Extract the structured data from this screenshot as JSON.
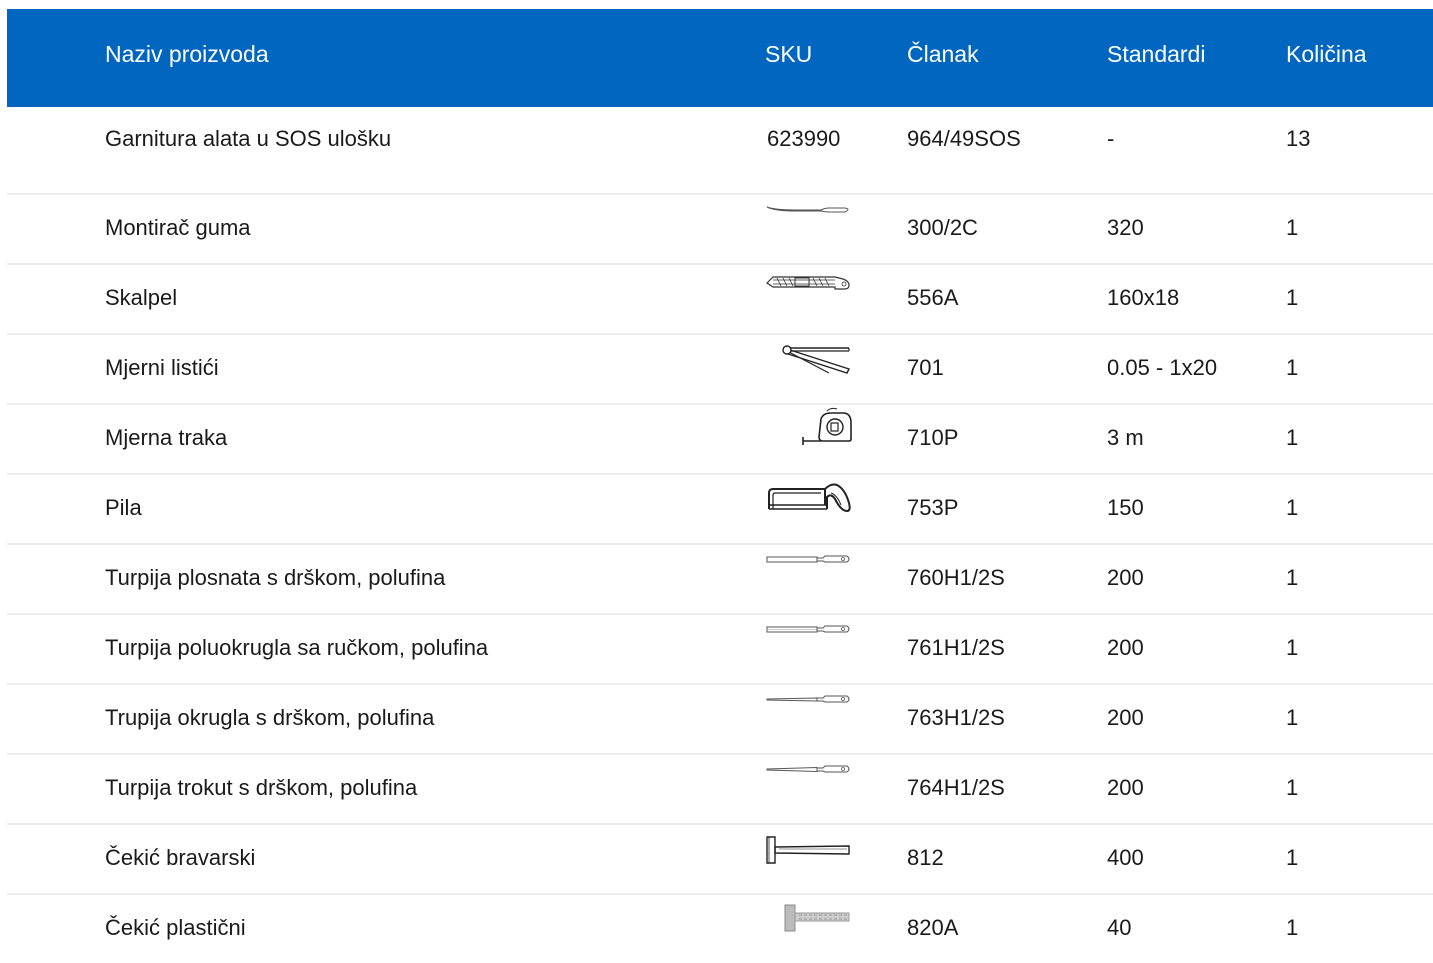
{
  "header": {
    "name": "Naziv proizvoda",
    "sku": "SKU",
    "article": "Članak",
    "standards": "Standardi",
    "quantity": "Količina"
  },
  "rows": [
    {
      "name": "Garnitura alata u SOS ulošku",
      "sku": "623990",
      "article": "964/49SOS",
      "standard": "-",
      "qty": "13"
    },
    {
      "name": "Montirač guma",
      "sku_icon": "tire-lever-icon",
      "article": "300/2C",
      "standard": "320",
      "qty": "1"
    },
    {
      "name": "Skalpel",
      "sku_icon": "utility-knife-icon",
      "article": "556A",
      "standard": "160x18",
      "qty": "1"
    },
    {
      "name": "Mjerni listići",
      "sku_icon": "feeler-gauge-icon",
      "article": "701",
      "standard": "0.05 - 1x20",
      "qty": "1"
    },
    {
      "name": "Mjerna traka",
      "sku_icon": "tape-measure-icon",
      "article": "710P",
      "standard": "3 m",
      "qty": "1"
    },
    {
      "name": "Pila",
      "sku_icon": "hacksaw-icon",
      "article": "753P",
      "standard": "150",
      "qty": "1"
    },
    {
      "name": "Turpija plosnata s drškom, polufina",
      "sku_icon": "flat-file-icon",
      "article": "760H1/2S",
      "standard": "200",
      "qty": "1"
    },
    {
      "name": "Turpija poluokrugla sa ručkom, polufina",
      "sku_icon": "half-round-file-icon",
      "article": "761H1/2S",
      "standard": "200",
      "qty": "1"
    },
    {
      "name": "Trupija okrugla s drškom, polufina",
      "sku_icon": "round-file-icon",
      "article": "763H1/2S",
      "standard": "200",
      "qty": "1"
    },
    {
      "name": "Turpija trokut s drškom, polufina",
      "sku_icon": "triangle-file-icon",
      "article": "764H1/2S",
      "standard": "200",
      "qty": "1"
    },
    {
      "name": "Čekić bravarski",
      "sku_icon": "locksmith-hammer-icon",
      "article": "812",
      "standard": "400",
      "qty": "1"
    },
    {
      "name": "Čekić plastični",
      "sku_icon": "plastic-hammer-icon",
      "article": "820A",
      "standard": "40",
      "qty": "1"
    }
  ],
  "colors": {
    "header_bg": "#0066bf",
    "header_text": "#ffffff",
    "row_divider": "#ececec"
  }
}
